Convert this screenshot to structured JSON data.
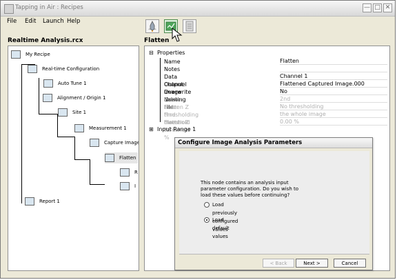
{
  "window": {
    "title": "Tapping in Air : Recipes",
    "controls": {
      "minimize": "—",
      "maximize": "□",
      "close": "✕"
    }
  },
  "menu": [
    "File",
    "Edit",
    "Launch",
    "Help"
  ],
  "toolbar": {
    "buttons": [
      {
        "icon": "rocket-icon"
      },
      {
        "icon": "analysis-icon"
      },
      {
        "icon": "document-icon"
      }
    ]
  },
  "left_panel": {
    "title": "Realtime Analysis.rcx",
    "items": [
      {
        "label": "My Recipe",
        "icon": "recipe-icon"
      },
      {
        "label": "Real-time Configuration",
        "icon": "microscope-icon"
      },
      {
        "label": "Auto Tune 1",
        "icon": "tune-icon"
      },
      {
        "label": "Alignment / Origin 1",
        "icon": "alignment-icon"
      },
      {
        "label": "Site 1",
        "icon": "site-icon"
      },
      {
        "label": "Measurement 1",
        "icon": "measurement-icon"
      },
      {
        "label": "Capture Image",
        "icon": "camera-icon"
      },
      {
        "label": "Flatten",
        "icon": "flatten-icon"
      },
      {
        "label": "R",
        "icon": "r-icon"
      },
      {
        "label": "I",
        "icon": "i-icon"
      },
      {
        "label": "Report 1",
        "icon": "report-icon"
      }
    ]
  },
  "right_panel": {
    "title": "Flatten",
    "properties_label": "Properties",
    "properties": [
      {
        "name": "Name",
        "value": "Flatten"
      },
      {
        "name": "Notes",
        "value": ""
      },
      {
        "name": "Data Channel",
        "value": "Channel 1"
      },
      {
        "name": "Output Image Name",
        "value": "Flattened Captured Image.000"
      },
      {
        "name": "Overwrite Existing File",
        "value": "No"
      },
      {
        "name": "Flatten order",
        "value": "2nd"
      },
      {
        "name": "Flatten Z thresholding direction",
        "value": "No thresholding"
      },
      {
        "name": "Find threshold for",
        "value": "the whole image"
      },
      {
        "name": "Flatten Z threshold %",
        "value": "0.00 %"
      }
    ],
    "input_range": "Input Range 1"
  },
  "dialog": {
    "title": "Configure Image Analysis Parameters",
    "text": "This node contains an analysis input parameter configuration.  Do you wish to load these values before continuing?",
    "options": [
      {
        "label": "Load previously configured values"
      },
      {
        "label": "Load default values"
      }
    ],
    "buttons": {
      "back": "< Back",
      "next": "Next >",
      "cancel": "Cancel"
    }
  }
}
